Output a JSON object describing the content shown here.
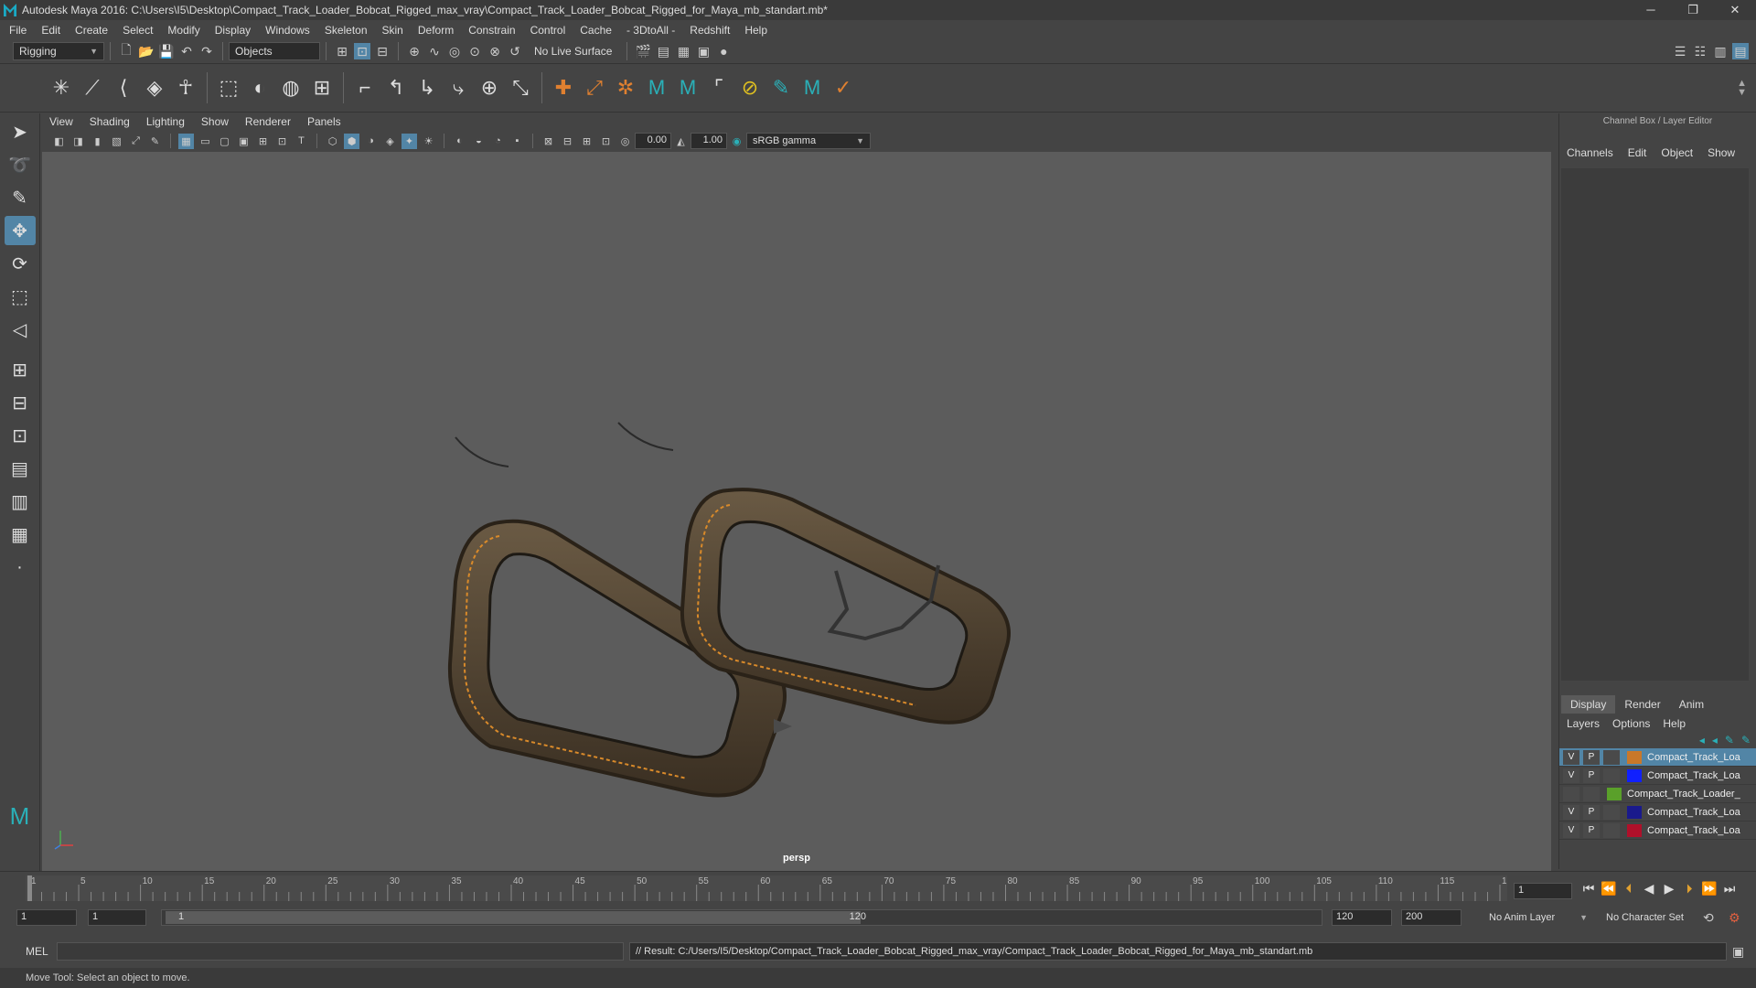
{
  "window": {
    "title": "Autodesk Maya 2016: C:\\Users\\I5\\Desktop\\Compact_Track_Loader_Bobcat_Rigged_max_vray\\Compact_Track_Loader_Bobcat_Rigged_for_Maya_mb_standart.mb*",
    "minimize": "─",
    "maximize": "❐",
    "close": "✕"
  },
  "menubar": [
    "File",
    "Edit",
    "Create",
    "Select",
    "Modify",
    "Display",
    "Windows",
    "Skeleton",
    "Skin",
    "Deform",
    "Constrain",
    "Control",
    "Cache",
    "- 3DtoAll -",
    "Redshift",
    "Help"
  ],
  "statusline": {
    "mode": "Rigging",
    "selection_mode": "Objects",
    "live_surface": "No Live Surface"
  },
  "panel": {
    "menus": [
      "View",
      "Shading",
      "Lighting",
      "Show",
      "Renderer",
      "Panels"
    ],
    "exposure": "0.00",
    "gamma": "1.00",
    "color_space": "sRGB gamma",
    "camera_label": "persp"
  },
  "channelbox": {
    "header": "Channel Box / Layer Editor",
    "tabs": [
      "Channels",
      "Edit",
      "Object",
      "Show"
    ]
  },
  "layers": {
    "tabs": [
      "Display",
      "Render",
      "Anim"
    ],
    "active_tab": "Display",
    "menu": [
      "Layers",
      "Options",
      "Help"
    ],
    "rows": [
      {
        "v": "V",
        "p": "P",
        "color": "#c9782a",
        "name": "Compact_Track_Loa",
        "selected": true
      },
      {
        "v": "V",
        "p": "P",
        "color": "#1020ff",
        "name": "Compact_Track_Loa",
        "selected": false
      },
      {
        "v": "",
        "p": "",
        "color": "#5aa02a",
        "name": "Compact_Track_Loader_",
        "selected": false
      },
      {
        "v": "V",
        "p": "P",
        "color": "#1a1a8c",
        "name": "Compact_Track_Loa",
        "selected": false
      },
      {
        "v": "V",
        "p": "P",
        "color": "#b0102a",
        "name": "Compact_Track_Loa",
        "selected": false
      }
    ]
  },
  "timeslider": {
    "ticks": [
      "1",
      "5",
      "10",
      "15",
      "20",
      "25",
      "30",
      "35",
      "40",
      "45",
      "50",
      "55",
      "60",
      "65",
      "70",
      "75",
      "80",
      "85",
      "90",
      "95",
      "100",
      "105",
      "110",
      "115",
      "120"
    ],
    "current_frame": "1",
    "range_start": "1",
    "range_inner_start": "1",
    "range_slider_start": "1",
    "range_slider_end": "120",
    "range_end": "120",
    "range_outer_end": "200",
    "anim_layer": "No Anim Layer",
    "character_set": "No Character Set"
  },
  "cmdline": {
    "label": "MEL",
    "result": "// Result: C:/Users/I5/Desktop/Compact_Track_Loader_Bobcat_Rigged_max_vray/Compact_Track_Loader_Bobcat_Rigged_for_Maya_mb_standart.mb"
  },
  "helpline": "Move Tool: Select an object to move.",
  "colors": {
    "accent": "#5285a6",
    "viewport_bg": "#5c5c5c",
    "track_orange": "#d98a2a"
  }
}
